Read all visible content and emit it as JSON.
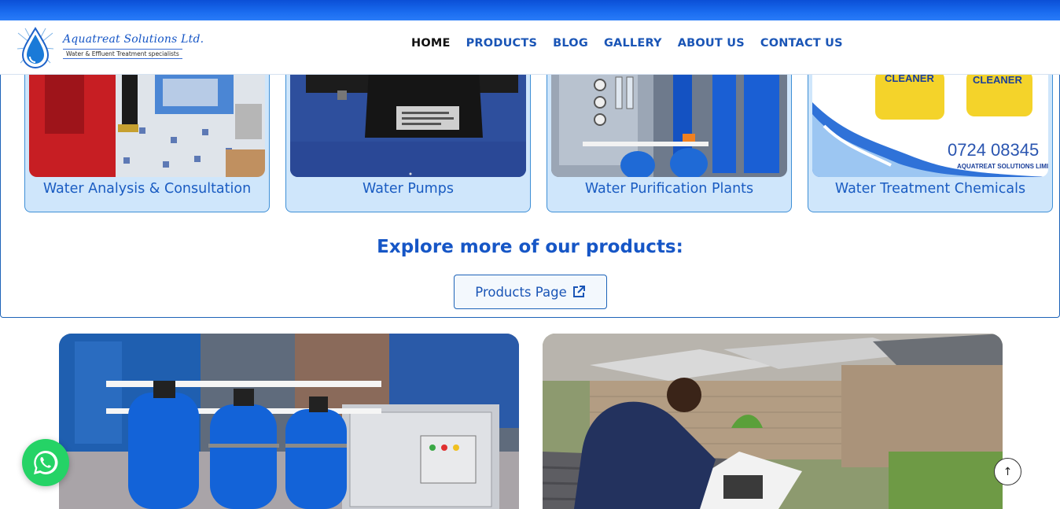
{
  "brand": {
    "name": "Aquatreat Solutions Ltd.",
    "tagline": "Water & Effluent Treatment specialists",
    "logo_icon": "water-drop-icon",
    "primary_color": "#1656c6"
  },
  "nav": {
    "items": [
      {
        "label": "HOME",
        "active": true
      },
      {
        "label": "PRODUCTS",
        "active": false
      },
      {
        "label": "BLOG",
        "active": false
      },
      {
        "label": "GALLERY",
        "active": false
      },
      {
        "label": "ABOUT US",
        "active": false
      },
      {
        "label": "CONTACT US",
        "active": false
      }
    ]
  },
  "product_cards": [
    {
      "title": "Water Analysis & Consultation"
    },
    {
      "title": "Water Pumps"
    },
    {
      "title": "Water Purification Plants"
    },
    {
      "title": "Water Treatment Chemicals",
      "image_text": {
        "label1": "CLEANER",
        "label2": "CLEANER",
        "phone": "0724 08345",
        "company": "AQUATREAT SOLUTIONS LIMIT"
      }
    }
  ],
  "explore": {
    "heading": "Explore more of our products:",
    "button_label": "Products Page",
    "button_icon": "external-link-icon"
  },
  "floating": {
    "whatsapp_icon": "whatsapp-icon",
    "scroll_top_icon": "arrow-up-icon",
    "scroll_top_glyph": "↑"
  }
}
